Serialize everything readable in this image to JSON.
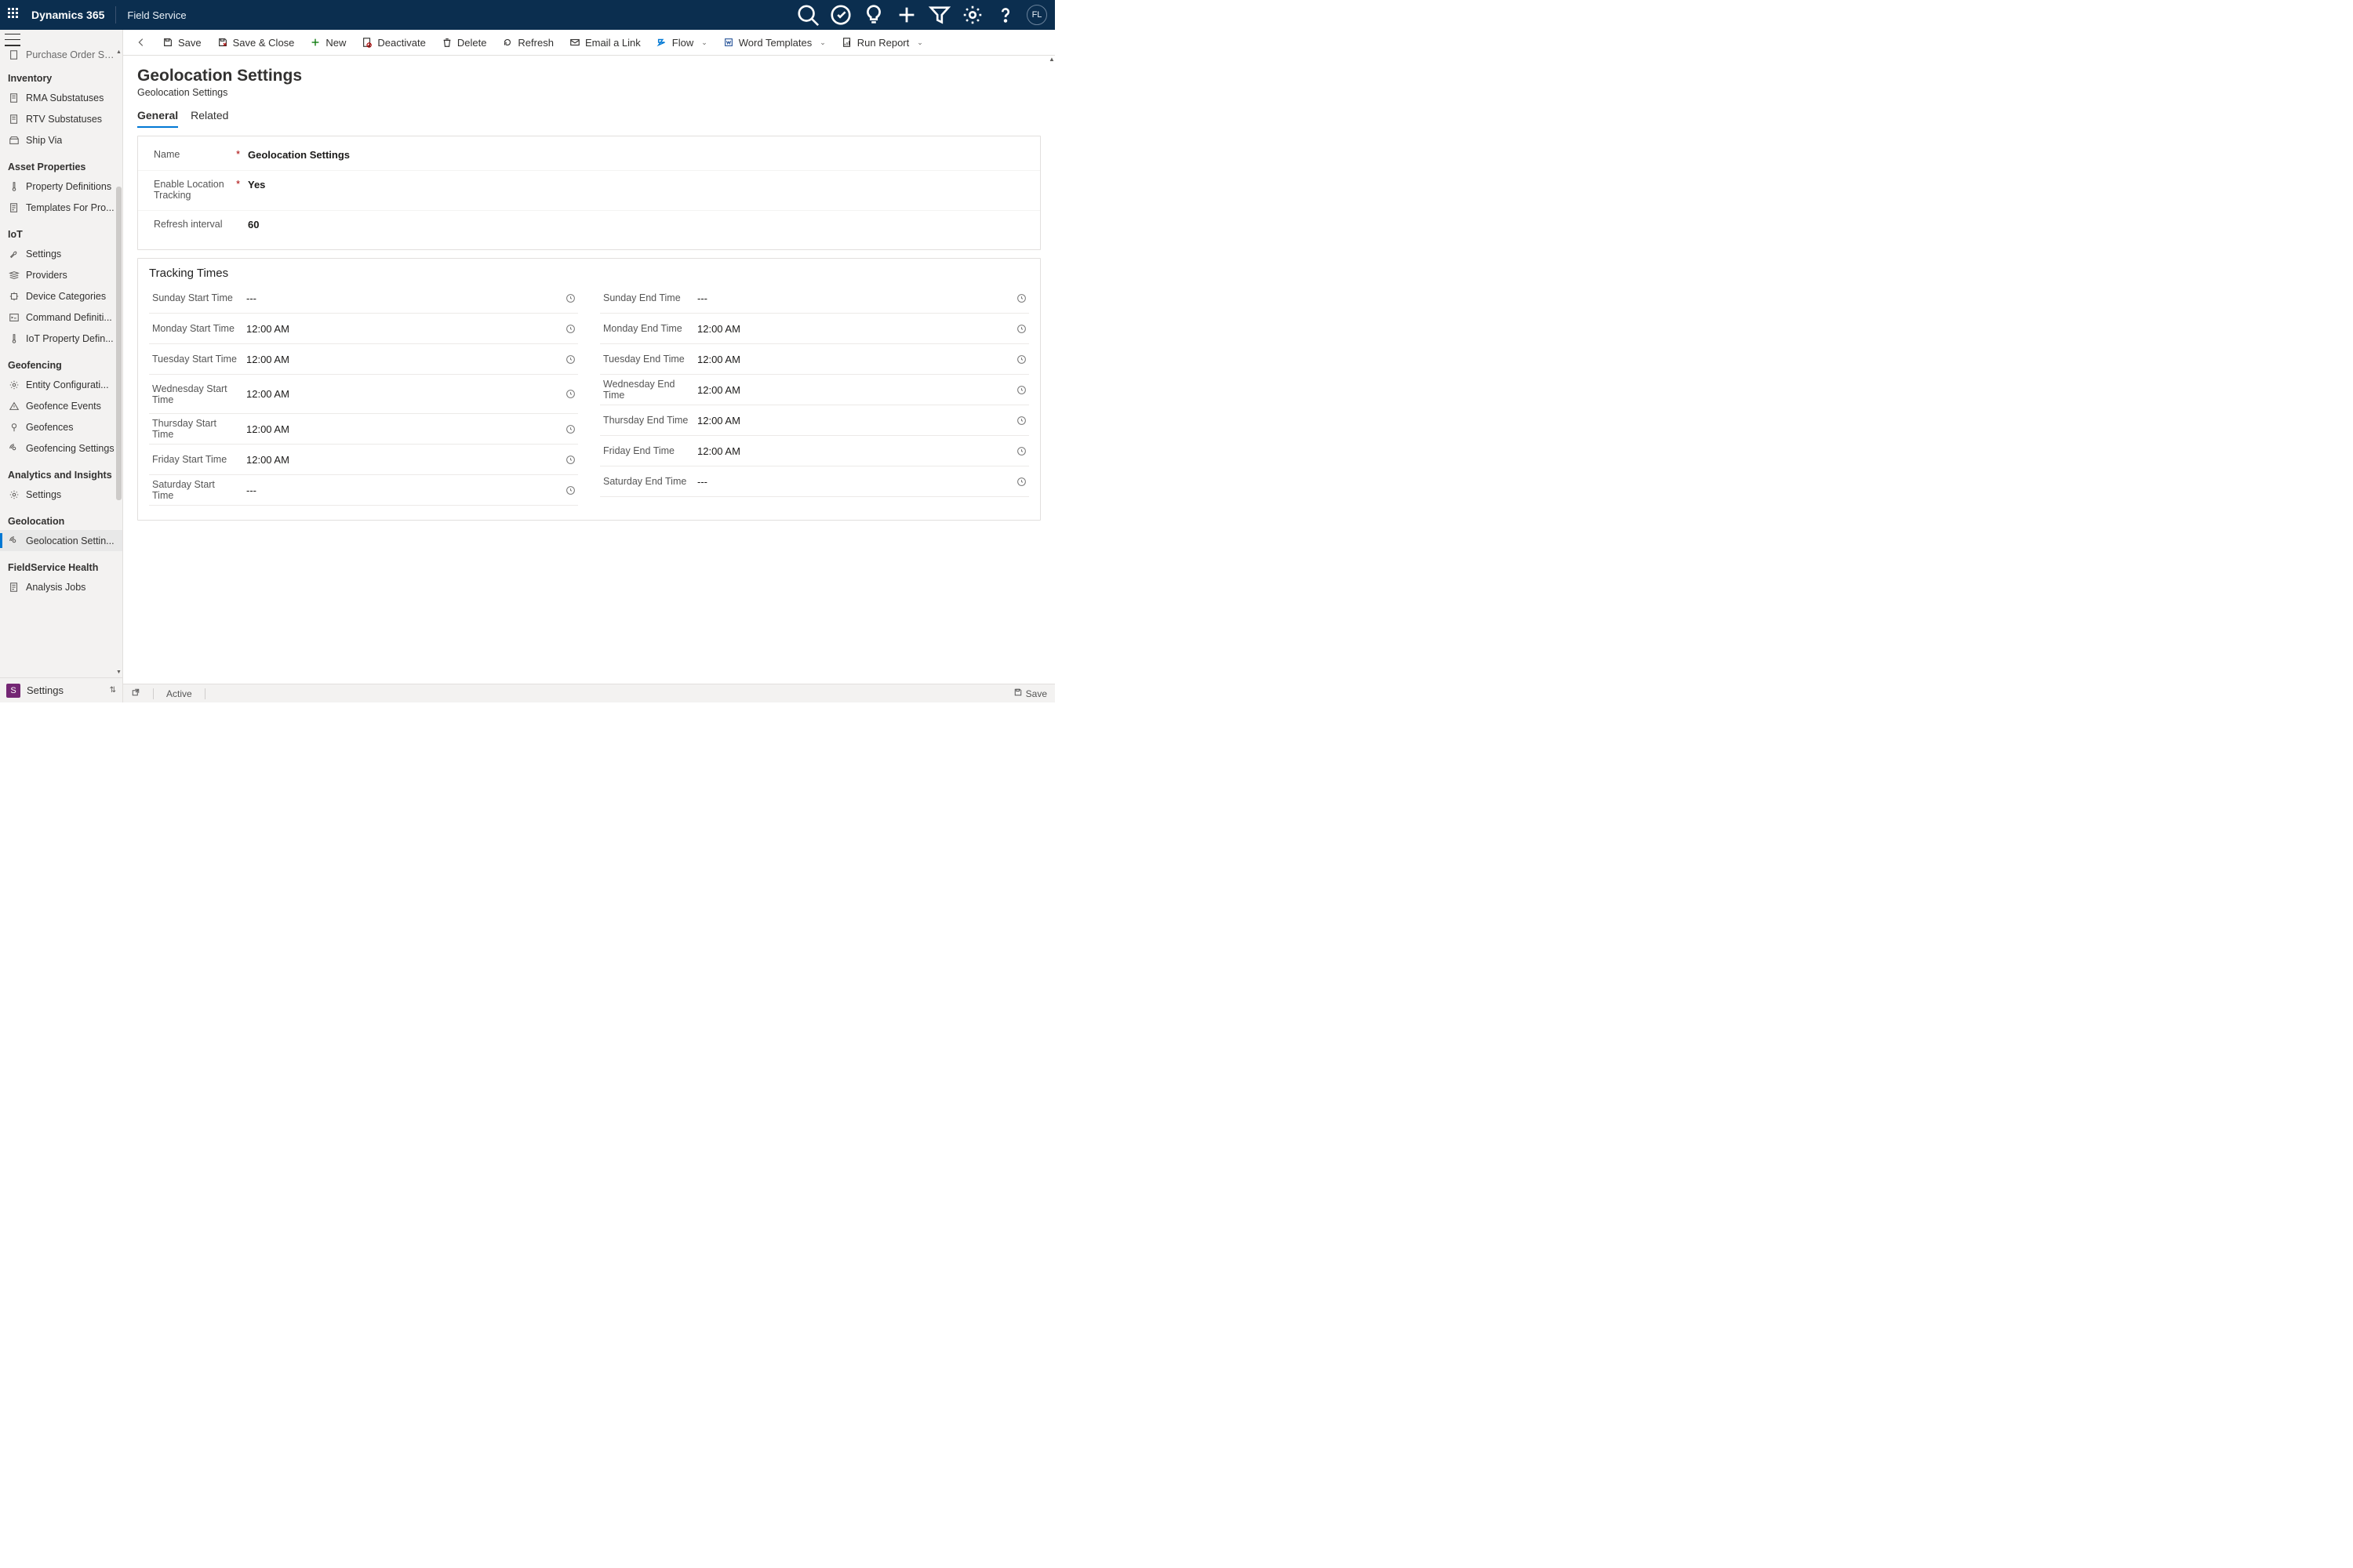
{
  "topbar": {
    "brand": "Dynamics 365",
    "app": "Field Service",
    "avatar": "FL"
  },
  "sidebar": {
    "truncated_above": "Purchase Order Su...",
    "groups": [
      {
        "title": "Inventory",
        "items": [
          {
            "label": "RMA Substatuses",
            "icon": "doc"
          },
          {
            "label": "RTV Substatuses",
            "icon": "doc"
          },
          {
            "label": "Ship Via",
            "icon": "box"
          }
        ]
      },
      {
        "title": "Asset Properties",
        "items": [
          {
            "label": "Property Definitions",
            "icon": "thermo"
          },
          {
            "label": "Templates For Pro...",
            "icon": "page"
          }
        ]
      },
      {
        "title": "IoT",
        "items": [
          {
            "label": "Settings",
            "icon": "wrench"
          },
          {
            "label": "Providers",
            "icon": "stack"
          },
          {
            "label": "Device Categories",
            "icon": "chip"
          },
          {
            "label": "Command Definiti...",
            "icon": "cmd"
          },
          {
            "label": "IoT Property Defin...",
            "icon": "thermo"
          }
        ]
      },
      {
        "title": "Geofencing",
        "items": [
          {
            "label": "Entity Configurati...",
            "icon": "gear"
          },
          {
            "label": "Geofence Events",
            "icon": "warn"
          },
          {
            "label": "Geofences",
            "icon": "pin"
          },
          {
            "label": "Geofencing Settings",
            "icon": "radar"
          }
        ]
      },
      {
        "title": "Analytics and Insights",
        "items": [
          {
            "label": "Settings",
            "icon": "gear"
          }
        ]
      },
      {
        "title": "Geolocation",
        "items": [
          {
            "label": "Geolocation Settin...",
            "icon": "radar",
            "selected": true
          }
        ]
      },
      {
        "title": "FieldService Health",
        "items": [
          {
            "label": "Analysis Jobs",
            "icon": "page"
          }
        ]
      }
    ],
    "area": {
      "letter": "S",
      "label": "Settings"
    }
  },
  "commands": {
    "back": "←",
    "items": [
      {
        "label": "Save",
        "icon": "save"
      },
      {
        "label": "Save & Close",
        "icon": "saveclose"
      },
      {
        "label": "New",
        "icon": "plus",
        "color": "#107c10"
      },
      {
        "label": "Deactivate",
        "icon": "deact"
      },
      {
        "label": "Delete",
        "icon": "trash"
      },
      {
        "label": "Refresh",
        "icon": "refresh"
      },
      {
        "label": "Email a Link",
        "icon": "mail"
      },
      {
        "label": "Flow",
        "icon": "flow",
        "hasChevron": true
      },
      {
        "label": "Word Templates",
        "icon": "word",
        "hasChevron": true
      },
      {
        "label": "Run Report",
        "icon": "report",
        "hasChevron": true
      }
    ]
  },
  "page": {
    "title": "Geolocation Settings",
    "subtitle": "Geolocation Settings",
    "tabs": {
      "general": "General",
      "related": "Related"
    }
  },
  "fields": {
    "name": {
      "label": "Name",
      "value": "Geolocation Settings",
      "required": true
    },
    "enable": {
      "label": "Enable Location Tracking",
      "value": "Yes",
      "required": true
    },
    "refresh": {
      "label": "Refresh interval",
      "value": "60"
    }
  },
  "tracking": {
    "title": "Tracking Times",
    "left": [
      {
        "label": "Sunday Start Time",
        "value": "---"
      },
      {
        "label": "Monday Start Time",
        "value": "12:00 AM"
      },
      {
        "label": "Tuesday Start Time",
        "value": "12:00 AM"
      },
      {
        "label": "Wednesday Start Time",
        "value": "12:00 AM",
        "tall": true
      },
      {
        "label": "Thursday Start Time",
        "value": "12:00 AM"
      },
      {
        "label": "Friday Start Time",
        "value": "12:00 AM"
      },
      {
        "label": "Saturday Start Time",
        "value": "---"
      }
    ],
    "right": [
      {
        "label": "Sunday End Time",
        "value": "---"
      },
      {
        "label": "Monday End Time",
        "value": "12:00 AM"
      },
      {
        "label": "Tuesday End Time",
        "value": "12:00 AM"
      },
      {
        "label": "Wednesday End Time",
        "value": "12:00 AM"
      },
      {
        "label": "Thursday End Time",
        "value": "12:00 AM"
      },
      {
        "label": "Friday End Time",
        "value": "12:00 AM"
      },
      {
        "label": "Saturday End Time",
        "value": "---"
      }
    ]
  },
  "statusbar": {
    "status": "Active",
    "save": "Save"
  }
}
